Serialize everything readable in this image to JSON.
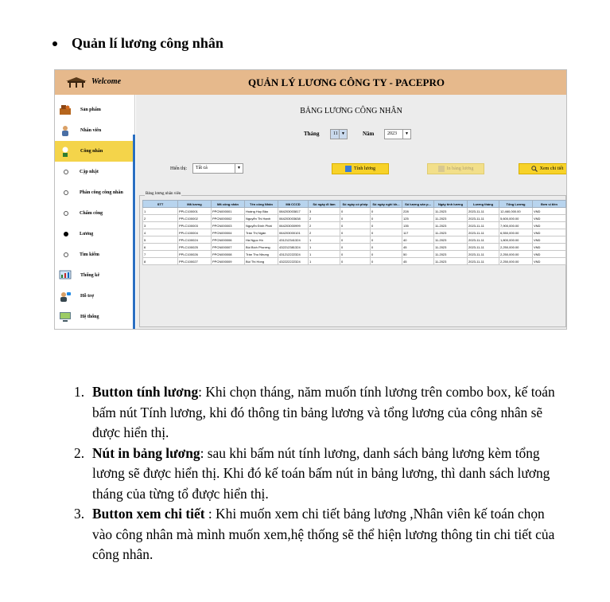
{
  "heading": "Quản lí lương công nhân",
  "app": {
    "welcome": "Welcome",
    "title": "QUẢN LÝ LƯƠNG CÔNG TY - PACEPRO",
    "sidebar": [
      {
        "label": "Sản phẩm",
        "icon": "product-icon"
      },
      {
        "label": "Nhân viên",
        "icon": "employee-icon"
      },
      {
        "label": "Công nhân",
        "icon": "worker-icon",
        "active": true
      }
    ],
    "submenu": [
      {
        "label": "Cập nhật",
        "selected": false
      },
      {
        "label": "Phân công công nhân",
        "selected": false
      },
      {
        "label": "Chấm công",
        "selected": false
      },
      {
        "label": "Lương",
        "selected": true
      },
      {
        "label": "Tìm kiếm",
        "selected": false
      }
    ],
    "sidebar_bottom": [
      {
        "label": "Thống kê",
        "icon": "statistics-icon"
      },
      {
        "label": "Hỗ trợ",
        "icon": "support-icon"
      },
      {
        "label": "Hệ thống",
        "icon": "system-icon"
      }
    ],
    "content": {
      "title": "BẢNG LƯƠNG CÔNG NHÂN",
      "month_label": "Tháng",
      "month_value": "11",
      "year_label": "Năm",
      "year_value": "2023",
      "show_label": "Hiển thị:",
      "show_value": "Tất cả",
      "btn_calc": "Tính lương",
      "btn_print": "In bảng lương",
      "btn_detail": "Xem chi tiết",
      "group_label": "Bảng lương nhân viên",
      "columns": [
        "STT",
        "Mã lương",
        "Mã công nhân",
        "Tên công Nhân",
        "Mã CCCD",
        "Số ngày đi làm",
        "Số ngày có phép",
        "Số ngày nghỉ kh...",
        "Số lượng sản p...",
        "Ngày tính lương",
        "Lương tháng",
        "Tổng Lương",
        "Đơn vị tiền"
      ],
      "rows": [
        [
          "1",
          "PPLC100001",
          "PPCN000001",
          "Hoàng Huy Bảo",
          "084203003817",
          "3",
          "0",
          "0",
          "228",
          "11-2023",
          "2023-11-11",
          "12,460,000.00",
          "VND"
        ],
        [
          "2",
          "PPLC100002",
          "PPCN000002",
          "Nguyễn Thị Hạnh",
          "064203003638",
          "2",
          "0",
          "0",
          "125",
          "11-2023",
          "2023-11-11",
          "5,600,000.00",
          "VND"
        ],
        [
          "3",
          "PPLC100003",
          "PPCN000003",
          "Nguyễn Đình Phát",
          "064203000999",
          "2",
          "0",
          "0",
          "135",
          "11-2023",
          "2023-11-11",
          "7,900,000.00",
          "VND"
        ],
        [
          "4",
          "PPLC100004",
          "PPCN000004",
          "Trần Thị Ngân",
          "064203000101",
          "2",
          "0",
          "0",
          "117",
          "11-2023",
          "2023-11-11",
          "6,550,000.00",
          "VND"
        ],
        [
          "5",
          "PPLC100024",
          "PPCN000006",
          "Hà Ngọc Hồ",
          "431212341324",
          "1",
          "0",
          "0",
          "40",
          "11-2023",
          "2023-11-11",
          "1,800,000.00",
          "VND"
        ],
        [
          "6",
          "PPLC100025",
          "PPCN000007",
          "Bùi Bích Phương",
          "432212381324",
          "1",
          "0",
          "0",
          "45",
          "11-2023",
          "2023-11-11",
          "2,250,000.00",
          "VND"
        ],
        [
          "7",
          "PPLC100026",
          "PPCN000008",
          "Trần Thu Nhung",
          "431212222324",
          "1",
          "0",
          "0",
          "50",
          "11-2023",
          "2023-11-11",
          "2,250,000.00",
          "VND"
        ],
        [
          "8",
          "PPLC100027",
          "PPCN000009",
          "Bùi Thị Hồng",
          "432222222324",
          "1",
          "0",
          "0",
          "45",
          "11-2023",
          "2023-11-11",
          "2,250,000.00",
          "VND"
        ]
      ]
    }
  },
  "items": [
    {
      "num": "1.",
      "bold": "Button tính lương",
      "text": ": Khi chọn tháng, năm muốn tính lương trên combo box, kế toán bấm nút Tính lương, khi đó thông tin bảng lương và tổng lương của công nhân sẽ được hiển thị."
    },
    {
      "num": "2.",
      "bold": "Nút in bảng lương",
      "text": ": sau khi bấm nút tính lương, danh sách bảng lương kèm tổng lương sẽ được hiển thị. Khi đó kế toán bấm nút in bảng lương, thì danh sách lương tháng của từng tổ được hiển thị."
    },
    {
      "num": "3.",
      "bold": "Button xem chi tiết",
      "text": " : Khi muốn xem chi tiết bảng lương ,Nhân viên kế toán chọn vào công nhân mà mình muốn xem,hệ thống sẽ thể hiện lương thông tin chi tiết của công nhân."
    }
  ]
}
